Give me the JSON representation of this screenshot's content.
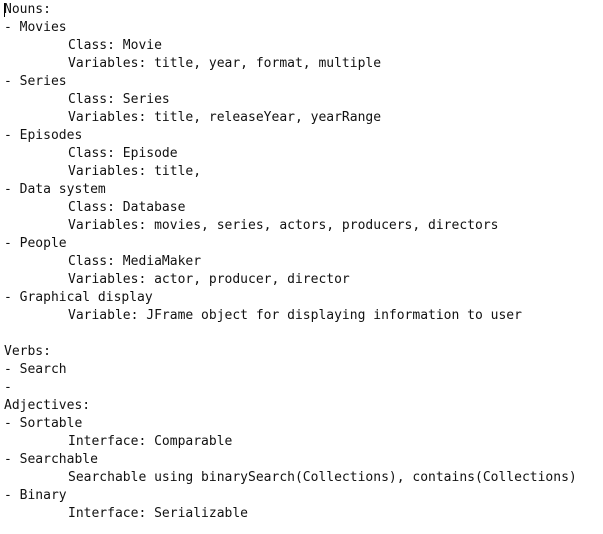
{
  "document": {
    "lines": [
      {
        "text": "Nouns:"
      },
      {
        "text": "- Movies"
      },
      {
        "text": "Class: Movie",
        "indent": true
      },
      {
        "text": "Variables: title, year, format, multiple",
        "indent": true
      },
      {
        "text": "- Series"
      },
      {
        "text": "Class: Series",
        "indent": true
      },
      {
        "text": "Variables: title, releaseYear, yearRange",
        "indent": true
      },
      {
        "text": "- Episodes"
      },
      {
        "text": "Class: Episode",
        "indent": true
      },
      {
        "text": "Variables: title,",
        "indent": true
      },
      {
        "text": "- Data system"
      },
      {
        "text": "Class: Database",
        "indent": true
      },
      {
        "text": "Variables: movies, series, actors, producers, directors",
        "indent": true
      },
      {
        "text": "- People"
      },
      {
        "text": "Class: MediaMaker",
        "indent": true
      },
      {
        "text": "Variables: actor, producer, director",
        "indent": true
      },
      {
        "text": "- Graphical display"
      },
      {
        "text": "Variable: JFrame object for displaying information to user",
        "indent": true
      },
      {
        "text": ""
      },
      {
        "text": "Verbs:"
      },
      {
        "text": "- Search"
      },
      {
        "text": "-"
      },
      {
        "text": "Adjectives:"
      },
      {
        "text": "- Sortable"
      },
      {
        "text": "Interface: Comparable",
        "indent": true
      },
      {
        "text": "- Searchable"
      },
      {
        "text": "Searchable using binarySearch(Collections), contains(Collections)",
        "indent": true
      },
      {
        "text": "- Binary"
      },
      {
        "text": "Interface: Serializable",
        "indent": true
      }
    ]
  }
}
